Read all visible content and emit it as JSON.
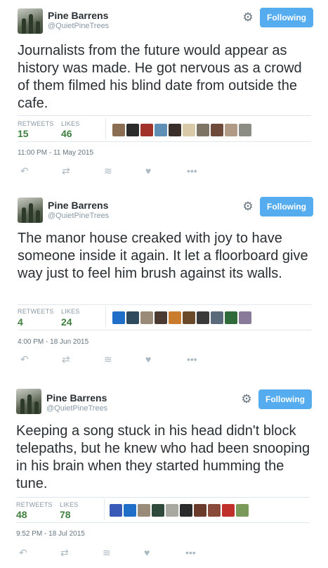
{
  "tweets": [
    {
      "name": "Pine Barrens",
      "handle": "@QuietPineTrees",
      "follow_label": "Following",
      "text": "Journalists from the future would appear as history was made. He got nervous as a crowd of them filmed his blind date from outside the cafe.",
      "retweets_label": "RETWEETS",
      "retweets": "15",
      "likes_label": "LIKES",
      "likes": "46",
      "timestamp": "11:00 PM - 11 May 2015",
      "face_colors": [
        "#8a6d52",
        "#2b2b2b",
        "#a0322a",
        "#5f8fb5",
        "#3a2f28",
        "#d8c9a8",
        "#7d7466",
        "#6d4a3a",
        "#b09a86",
        "#8c8c84"
      ]
    },
    {
      "name": "Pine Barrens",
      "handle": "@QuietPineTrees",
      "follow_label": "Following",
      "text": "The manor house creaked with joy to have someone inside it again. It let a floorboard give way just to feel him brush against its walls.",
      "retweets_label": "RETWEETS",
      "retweets": "4",
      "likes_label": "LIKES",
      "likes": "24",
      "timestamp": "4:00 PM - 18 Jun 2015",
      "face_colors": [
        "#1f6fc8",
        "#2e4a5c",
        "#9a8a78",
        "#4a3a32",
        "#c97b2e",
        "#6b4a2a",
        "#3a3a3a",
        "#5a6a7a",
        "#2f6a3a",
        "#8a7a9a"
      ]
    },
    {
      "name": "Pine Barrens",
      "handle": "@QuietPineTrees",
      "follow_label": "Following",
      "text": "Keeping a song stuck in his head didn't block telepaths, but he knew who had been snooping in his brain when they started humming the tune.",
      "retweets_label": "RETWEETS",
      "retweets": "48",
      "likes_label": "LIKES",
      "likes": "78",
      "timestamp": "9:52 PM - 18 Jul 2015",
      "face_colors": [
        "#3a5ab8",
        "#1f6fc8",
        "#9a8a78",
        "#2f4a3a",
        "#a8a8a0",
        "#2b2b2b",
        "#6a3a2a",
        "#8a4a3a",
        "#c0302a",
        "#7a9a5a"
      ]
    }
  ],
  "icons": {
    "gear": "gear-icon",
    "reply": "reply-icon",
    "retweet": "retweet-icon",
    "stack": "buffer-icon",
    "like": "heart-icon",
    "more": "more-icon"
  },
  "colors": {
    "follow_button": "#55acee",
    "stat_value": "#3f7f3f",
    "handle": "#8899a6",
    "divider": "#e1e8ed"
  }
}
